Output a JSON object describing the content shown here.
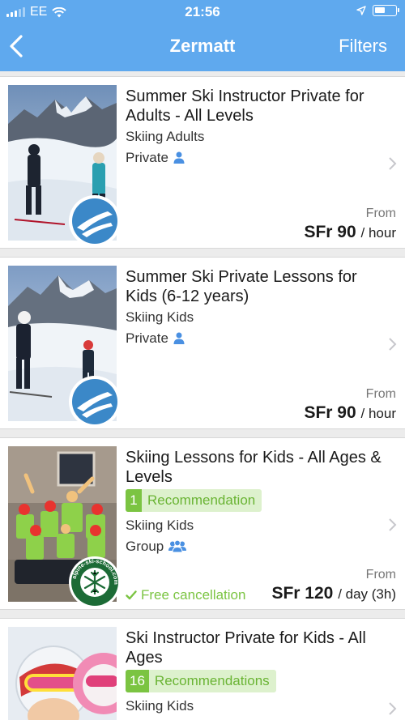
{
  "status": {
    "carrier": "EE",
    "time": "21:56"
  },
  "nav": {
    "title": "Zermatt",
    "filters_label": "Filters"
  },
  "listings": [
    {
      "title": "Summer Ski Instructor Private for Adults - All Levels",
      "category": "Skiing Adults",
      "type": "Private",
      "from": "From",
      "price": "SFr 90",
      "unit": "/ hour"
    },
    {
      "title": "Summer Ski Private Lessons for Kids (6-12 years)",
      "category": "Skiing Kids",
      "type": "Private",
      "from": "From",
      "price": "SFr 90",
      "unit": "/ hour"
    },
    {
      "title": "Skiing Lessons for Kids - All Ages & Levels",
      "rec_count": "1",
      "rec_label": "Recommendation",
      "category": "Skiing Kids",
      "type": "Group",
      "from": "From",
      "price": "SFr 120",
      "unit": "/ day (3h)",
      "free_cancellation": "Free cancellation"
    },
    {
      "title": "Ski Instructor Private for Kids - All Ages",
      "rec_count": "16",
      "rec_label": "Recommendations",
      "category": "Skiing Kids"
    }
  ],
  "badge_text": "alpine-ski-school.com",
  "colors": {
    "header": "#5fa9ee",
    "accent": "#4a90e2",
    "green": "#7bc442"
  }
}
